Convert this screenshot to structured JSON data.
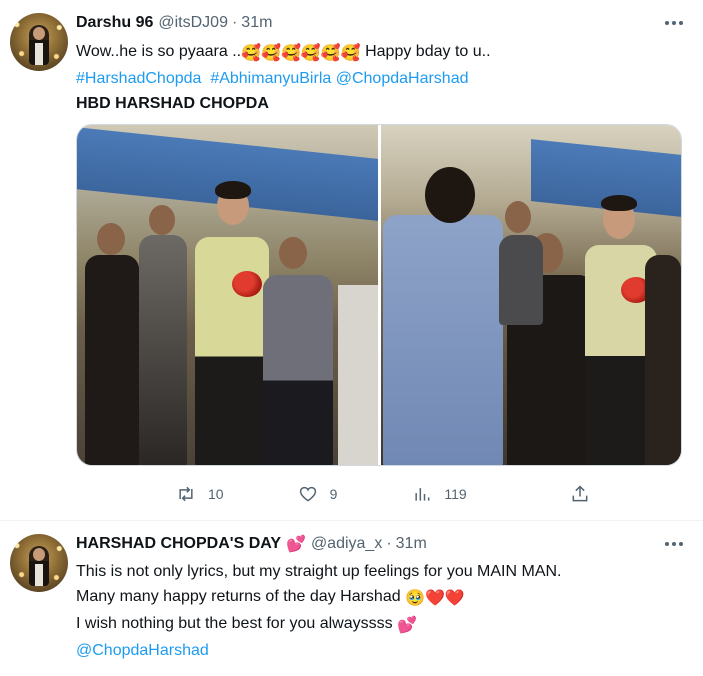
{
  "tweets": [
    {
      "name": "Darshu 96",
      "handle": "@itsDJ09",
      "sep": "·",
      "time": "31m",
      "line1_text": "Wow..he is so pyaara ..",
      "line1_emojis": "🥰🥰🥰🥰🥰🥰",
      "line1_tail": " Happy bday to u..",
      "hashtag1": "#HarshadChopda",
      "hashtag2": "#AbhimanyuBirla",
      "mention": "@ChopdaHarshad",
      "line3": "HBD HARSHAD CHOPDA",
      "actions": {
        "reply_count": "",
        "retweet_count": "10",
        "like_count": "9",
        "views_count": "119"
      },
      "icons": [
        "reply-icon",
        "retweet-icon",
        "like-icon",
        "views-icon",
        "share-icon"
      ]
    },
    {
      "name": "HARSHAD CHOPDA'S DAY",
      "name_emoji": "💕",
      "handle": "@adiya_x",
      "sep": "·",
      "time": "31m",
      "line1": "This is not only lyrics, but my straight up feelings for you MAIN MAN.",
      "line2_text": "Many many happy returns of the day Harshad ",
      "line2_emojis": "🥹❤️❤️",
      "line3_text": "I wish nothing but the best for you alwayssss ",
      "line3_emoji": "💕",
      "mention": "@ChopdaHarshad"
    }
  ],
  "colors": {
    "link": "#1d9bf0",
    "muted": "#536471",
    "text": "#0f1419",
    "divider": "#eff3f4"
  }
}
